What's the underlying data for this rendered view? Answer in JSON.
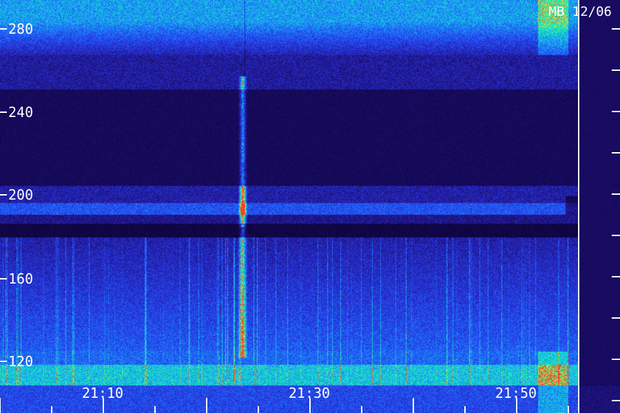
{
  "image": {
    "stamp": "MB 12/06",
    "y_axis": {
      "labels": [
        "280",
        "240",
        "200",
        "160",
        "120"
      ],
      "values": [
        280,
        240,
        200,
        160,
        120
      ]
    },
    "x_axis": {
      "labels": [
        "21:10",
        "21:30",
        "21:50"
      ]
    }
  },
  "colors": {
    "background": "#12064a",
    "low": "#1a0a60",
    "mid": "#2a3cf0",
    "high": "#18f0c0",
    "peak": "#e0e020",
    "hot": "#ff3030",
    "frame": "#ffffff"
  }
}
